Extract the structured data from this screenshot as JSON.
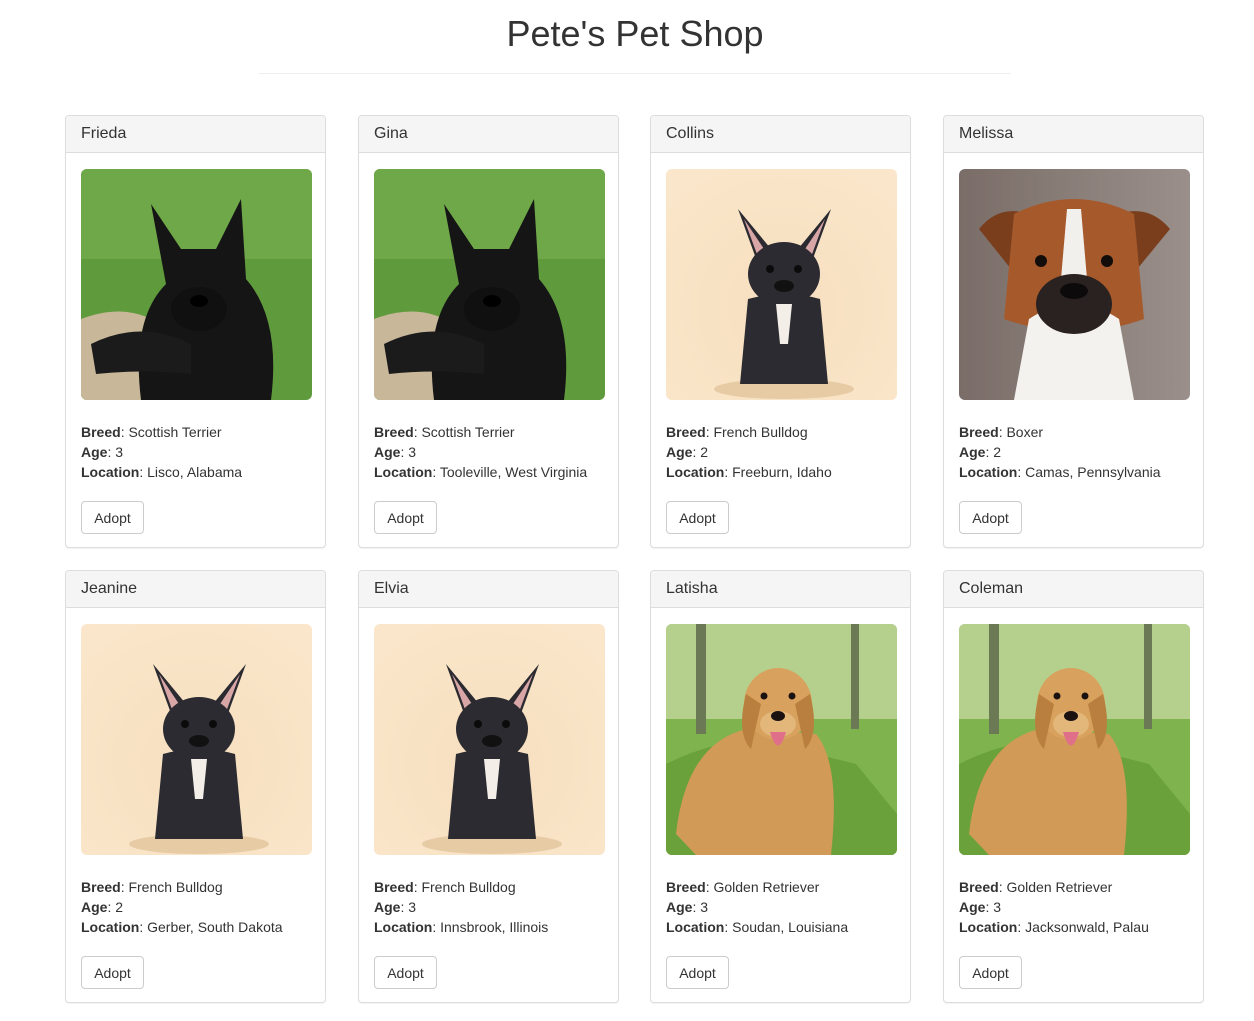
{
  "header": {
    "title": "Pete's Pet Shop"
  },
  "labels": {
    "breed": "Breed",
    "age": "Age",
    "location": "Location",
    "adopt": "Adopt"
  },
  "pets": [
    {
      "name": "Frieda",
      "breed": "Scottish Terrier",
      "age": "3",
      "location": "Lisco, Alabama",
      "photo": "scottish-terrier-photo"
    },
    {
      "name": "Gina",
      "breed": "Scottish Terrier",
      "age": "3",
      "location": "Tooleville, West Virginia",
      "photo": "scottish-terrier-photo"
    },
    {
      "name": "Collins",
      "breed": "French Bulldog",
      "age": "2",
      "location": "Freeburn, Idaho",
      "photo": "french-bulldog-photo"
    },
    {
      "name": "Melissa",
      "breed": "Boxer",
      "age": "2",
      "location": "Camas, Pennsylvania",
      "photo": "boxer-photo"
    },
    {
      "name": "Jeanine",
      "breed": "French Bulldog",
      "age": "2",
      "location": "Gerber, South Dakota",
      "photo": "french-bulldog-photo"
    },
    {
      "name": "Elvia",
      "breed": "French Bulldog",
      "age": "3",
      "location": "Innsbrook, Illinois",
      "photo": "french-bulldog-photo"
    },
    {
      "name": "Latisha",
      "breed": "Golden Retriever",
      "age": "3",
      "location": "Soudan, Louisiana",
      "photo": "golden-retriever-photo"
    },
    {
      "name": "Coleman",
      "breed": "Golden Retriever",
      "age": "3",
      "location": "Jacksonwald, Palau",
      "photo": "golden-retriever-photo"
    }
  ]
}
